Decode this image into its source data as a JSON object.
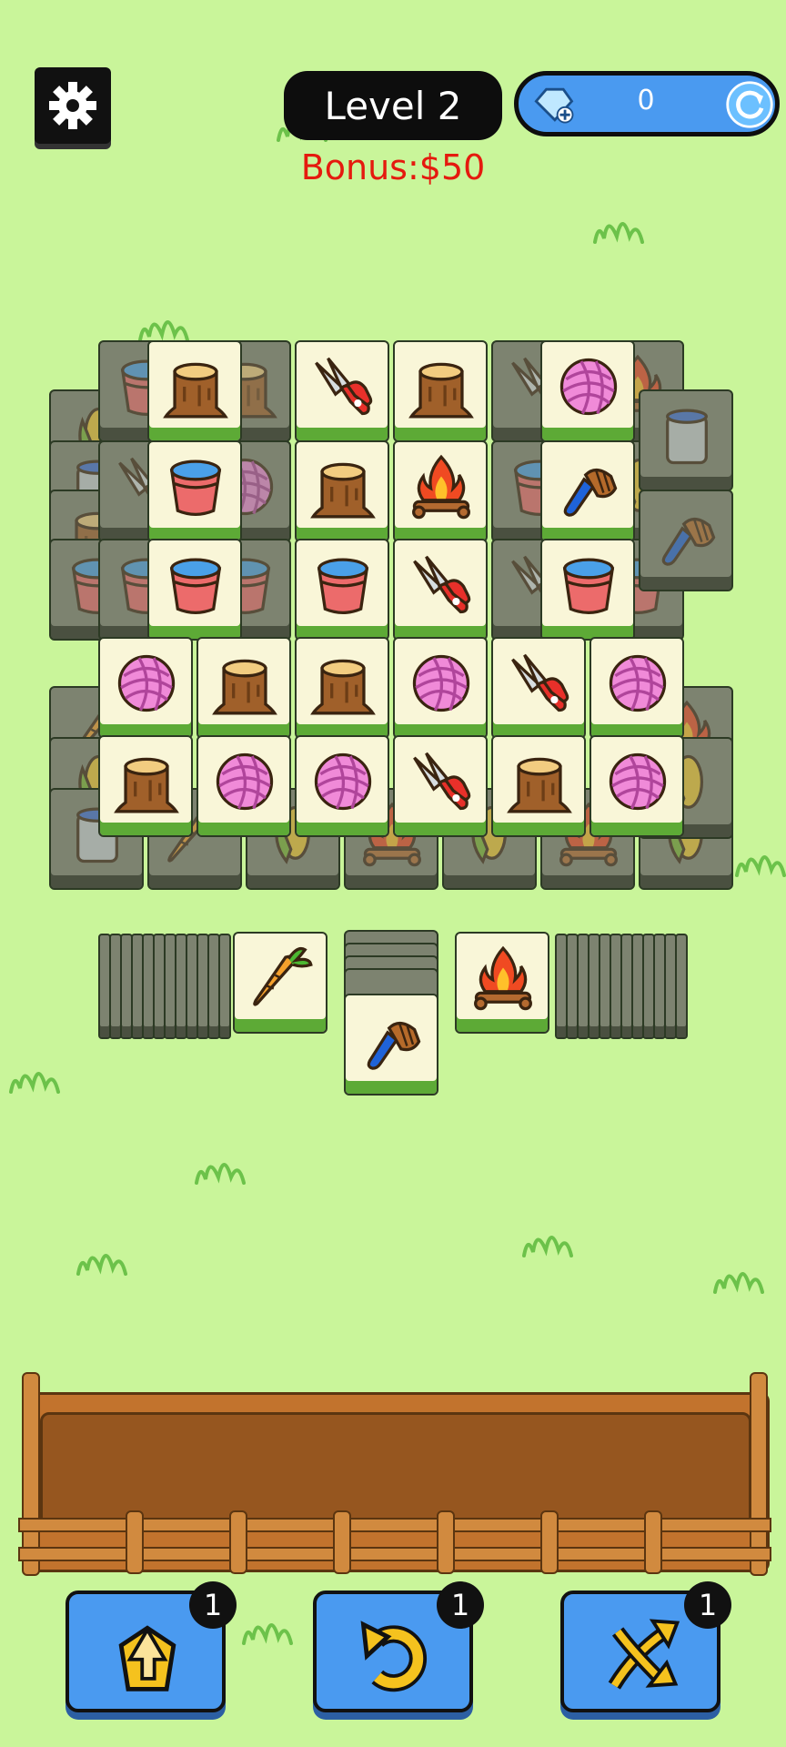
{
  "header": {
    "level_label": "Level 2",
    "bonus_label": "Bonus:$50",
    "gem_count": "0"
  },
  "boosters": [
    {
      "name": "hint",
      "icon": "pick-up-icon",
      "count": "1"
    },
    {
      "name": "undo",
      "icon": "undo-icon",
      "count": "1"
    },
    {
      "name": "shuffle",
      "icon": "shuffle-icon",
      "count": "1"
    }
  ],
  "board": {
    "top_tiles": [
      [
        "stump",
        "scissors",
        "stump",
        "yarn"
      ],
      [
        "bucket",
        "stump",
        "campfire",
        "brush"
      ],
      [
        "bucket",
        "bucket",
        "scissors",
        "bucket"
      ],
      [
        "yarn",
        "stump",
        "stump",
        "yarn",
        "scissors",
        "yarn"
      ],
      [
        "stump",
        "yarn",
        "yarn",
        "scissors",
        "stump",
        "yarn"
      ]
    ],
    "draw_piles": {
      "left_top": "carrot",
      "center_top": "brush",
      "right_top": "campfire"
    }
  },
  "colors": {
    "background": "#c9f59a",
    "tile_face": "#f9f6d8",
    "tile_edge": "#5daa36",
    "button_blue": "#4a9af0",
    "bonus_red": "#e51a0e",
    "tray_wood": "#c2732d"
  }
}
